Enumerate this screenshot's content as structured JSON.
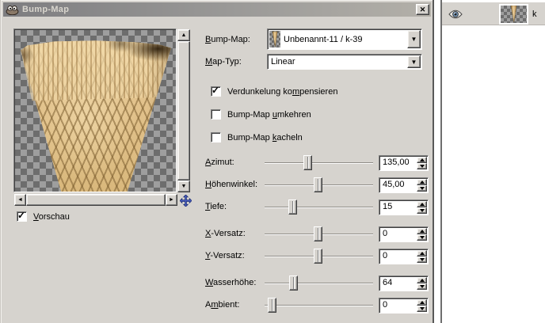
{
  "window": {
    "title": "Bump-Map"
  },
  "icons": {
    "close": "✕",
    "check": "✓",
    "combo_arrow": "▼",
    "scroll_up": "▲",
    "scroll_down": "▼",
    "scroll_left": "◄",
    "scroll_right": "►"
  },
  "preview": {
    "checkbox": {
      "text": "Vorschau",
      "u": 0
    },
    "checked": true
  },
  "fields": {
    "bump_map": {
      "label": {
        "text": "Bump-Map:",
        "u": 0
      },
      "value": "Unbenannt-11 / k-39"
    },
    "map_type": {
      "label": {
        "text": "Map-Typ:",
        "u": 0
      },
      "value": "Linear"
    }
  },
  "checkboxes": [
    {
      "label": {
        "text": "Verdunkelung kompensieren",
        "u": 15
      },
      "checked": true
    },
    {
      "label": {
        "text": "Bump-Map umkehren",
        "u": 9
      },
      "checked": false
    },
    {
      "label": {
        "text": "Bump-Map kacheln",
        "u": 9
      },
      "checked": false
    }
  ],
  "sliders": [
    {
      "label": {
        "text": "Azimut:",
        "u": 0
      },
      "value": "135,00",
      "pos": 0.39
    },
    {
      "label": {
        "text": "Höhenwinkel:",
        "u": 0
      },
      "value": "45,00",
      "pos": 0.49
    },
    {
      "label": {
        "text": "Tiefe:",
        "u": 0
      },
      "value": "15",
      "pos": 0.24
    },
    {
      "label": {
        "text": "X-Versatz:",
        "u": 0
      },
      "value": "0",
      "pos": 0.49
    },
    {
      "label": {
        "text": "Y-Versatz:",
        "u": 0
      },
      "value": "0",
      "pos": 0.49
    },
    {
      "label": {
        "text": "Wasserhöhe:",
        "u": 0
      },
      "value": "64",
      "pos": 0.25
    },
    {
      "label": {
        "text": "Ambient:",
        "u": 1
      },
      "value": "0",
      "pos": 0.03
    }
  ],
  "layers_panel": {
    "layer_name": "k"
  },
  "colors": {
    "dialog_bg": "#d6d3ce",
    "titlebar_gradient_from": "#7d7d80",
    "titlebar_gradient_to": "#b3b0a9",
    "title_text": "#d9d6ce",
    "basket_tan": "#e2c28c",
    "checker_light": "#9e9e9e",
    "checker_dark": "#6d6d6d",
    "pan_icon_blue": "#4a5fc0"
  }
}
